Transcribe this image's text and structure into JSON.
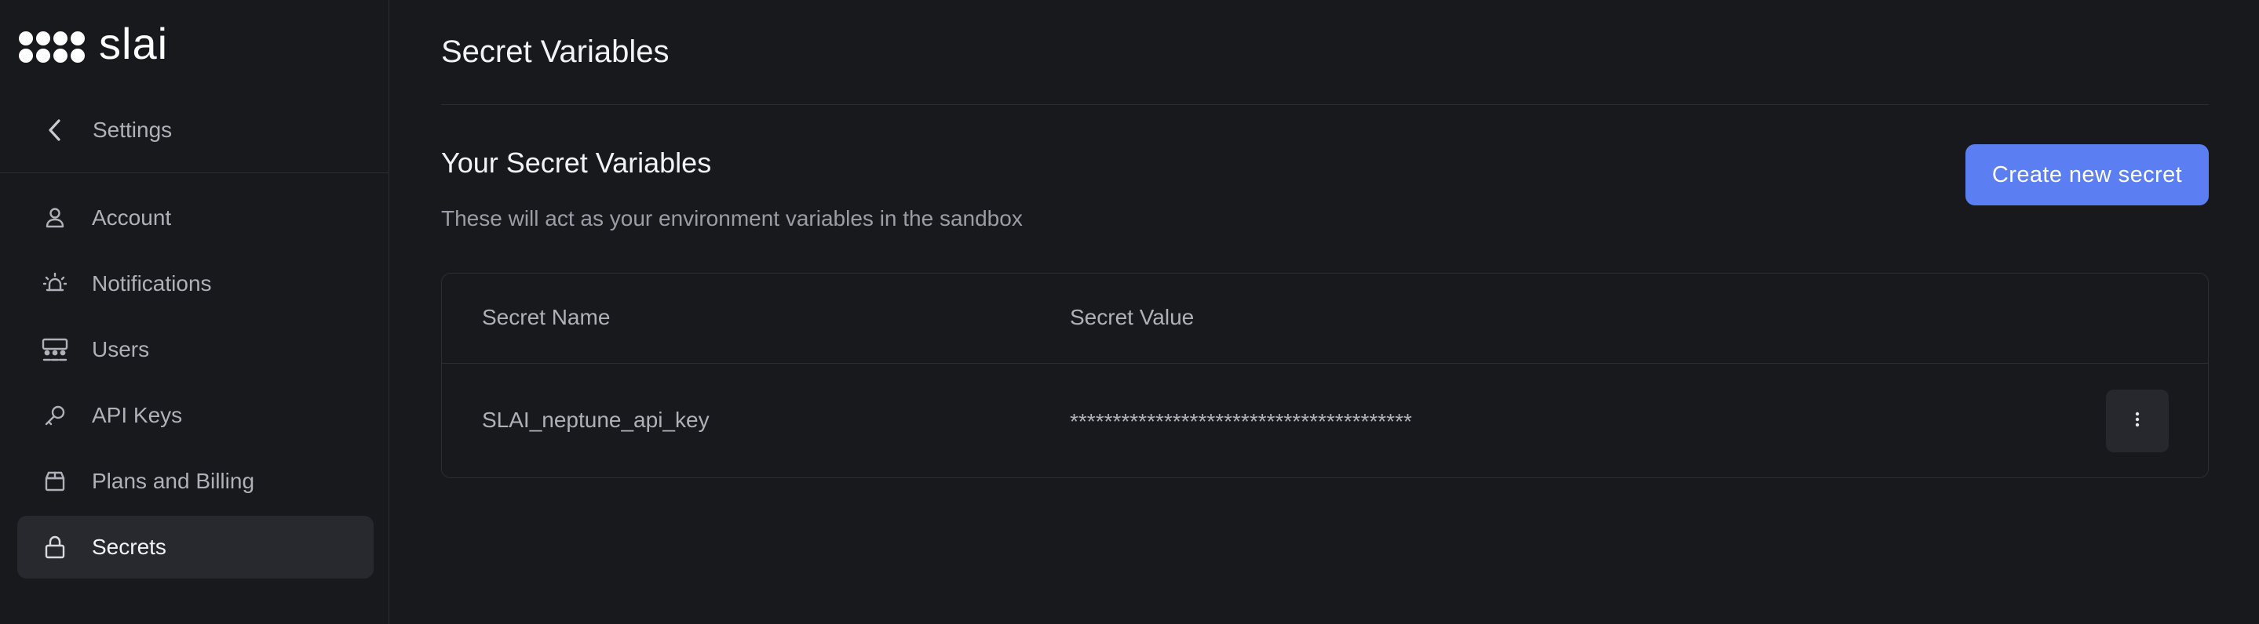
{
  "brand": {
    "name": "slai"
  },
  "sidebar": {
    "back_label": "Settings",
    "items": [
      {
        "label": "Account",
        "icon": "user-icon"
      },
      {
        "label": "Notifications",
        "icon": "alarm-icon"
      },
      {
        "label": "Users",
        "icon": "users-icon"
      },
      {
        "label": "API Keys",
        "icon": "key-icon"
      },
      {
        "label": "Plans and Billing",
        "icon": "box-icon"
      },
      {
        "label": "Secrets",
        "icon": "lock-icon",
        "active": true
      }
    ]
  },
  "main": {
    "page_title": "Secret Variables",
    "section_title": "Your Secret Variables",
    "section_subtitle": "These will act as your environment variables in the sandbox",
    "create_button": "Create new secret",
    "table": {
      "headers": [
        "Secret Name",
        "Secret Value"
      ],
      "rows": [
        {
          "name": "SLAI_neptune_api_key",
          "value": "****************************************"
        }
      ]
    }
  },
  "colors": {
    "background": "#18191d",
    "accent": "#5b7ff2",
    "active_item": "#28292e",
    "border": "#2c2e33"
  }
}
